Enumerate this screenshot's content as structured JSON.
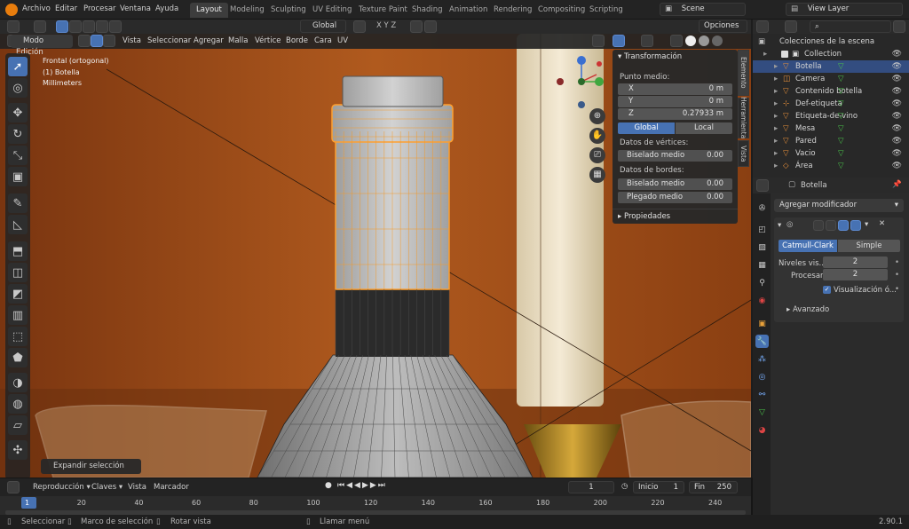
{
  "menu": [
    "Archivo",
    "Editar",
    "Procesar",
    "Ventana",
    "Ayuda"
  ],
  "workspaces": [
    "Layout",
    "Modeling",
    "Sculpting",
    "UV Editing",
    "Texture Paint",
    "Shading",
    "Animation",
    "Rendering",
    "Compositing",
    "Scripting"
  ],
  "active_workspace": "Layout",
  "scene": "Scene",
  "view_layer": "View Layer",
  "header": {
    "orientation": "Global",
    "options": "Opciones",
    "mode": "Modo Edición",
    "menus": [
      "Vista",
      "Seleccionar",
      "Agregar",
      "Malla",
      "Vértice",
      "Borde",
      "Cara",
      "UV"
    ]
  },
  "viewport_info": [
    "Frontal (ortogonal)",
    "(1) Botella",
    "Millimeters"
  ],
  "expand_selection": "Expandir selección",
  "npanel": {
    "title": "Transformación",
    "median": "Punto medio:",
    "x_label": "X",
    "x_value": "0 m",
    "y_label": "Y",
    "y_value": "0 m",
    "z_label": "Z",
    "z_value": "0.27933 m",
    "global": "Global",
    "local": "Local",
    "vertex_data": "Datos de vértices:",
    "bevel_mean": "Biselado medio",
    "bevel_mean_value": "0.00",
    "edge_data": "Datos de bordes:",
    "edge_bevel": "Biselado medio",
    "edge_bevel_value": "0.00",
    "crease": "Plegado medio",
    "crease_value": "0.00",
    "properties": "Propiedades"
  },
  "side_tabs": [
    "Elemento",
    "Herramienta",
    "Vista"
  ],
  "outliner": {
    "header": "Colecciones de la escena",
    "items": [
      {
        "name": "Collection",
        "icon": "collection-icon"
      },
      {
        "name": "Botella",
        "icon": "mesh-icon"
      },
      {
        "name": "Camera",
        "icon": "camera-icon"
      },
      {
        "name": "Contenido botella",
        "icon": "mesh-icon"
      },
      {
        "name": "Def-etiqueta",
        "icon": "empty-icon"
      },
      {
        "name": "Etiqueta-de-vino",
        "icon": "mesh-icon"
      },
      {
        "name": "Mesa",
        "icon": "mesh-icon"
      },
      {
        "name": "Pared",
        "icon": "mesh-icon"
      },
      {
        "name": "Vacio",
        "icon": "mesh-icon"
      },
      {
        "name": "Área",
        "icon": "light-icon"
      }
    ]
  },
  "properties": {
    "object": "Botella",
    "add_modifier": "Agregar modificador",
    "catmull": "Catmull-Clark",
    "simple": "Simple",
    "levels_label": "Niveles vis...",
    "levels_value": "2",
    "render_label": "Procesar",
    "render_value": "2",
    "optimal": "Visualización ó...",
    "advanced": "Avanzado"
  },
  "timeline": {
    "playback": "Reproducción",
    "keys": "Claves",
    "view": "Vista",
    "marker": "Marcador",
    "current_frame": "1",
    "start_label": "Inicio",
    "start": "1",
    "end_label": "Fin",
    "end": "250",
    "ticks": [
      "1",
      "20",
      "40",
      "60",
      "80",
      "100",
      "120",
      "140",
      "160",
      "180",
      "200",
      "220",
      "240"
    ]
  },
  "status": {
    "select": "Seleccionar",
    "box": "Marco de selección",
    "rotate": "Rotar vista",
    "menu": "Llamar menú",
    "version": "2.90.1"
  },
  "colors": {
    "accent": "#4772b3",
    "wall": "#8a3f12",
    "selected": "#ff9f2e"
  }
}
